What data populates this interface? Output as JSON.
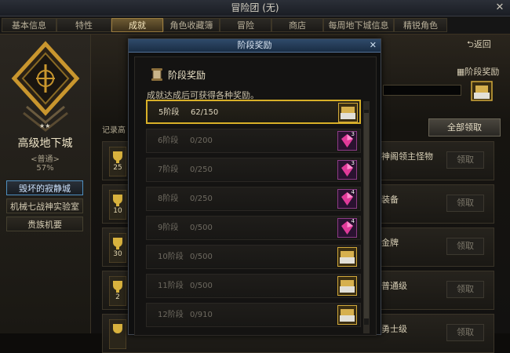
{
  "window": {
    "title": "冒险团 (无)",
    "close_label": "✕"
  },
  "tabs": [
    {
      "label": "基本信息",
      "active": false
    },
    {
      "label": "特性",
      "active": false
    },
    {
      "label": "成就",
      "active": true
    },
    {
      "label": "角色收藏簿",
      "active": false
    },
    {
      "label": "冒险",
      "active": false
    },
    {
      "label": "商店",
      "active": false
    },
    {
      "label": "每周地下城信息",
      "active": false
    },
    {
      "label": "精锐角色",
      "active": false
    }
  ],
  "left": {
    "title": "高级地下城",
    "difficulty": "<普通>",
    "percent": "57%",
    "dungeons": [
      {
        "label": "毁坏的寂静城",
        "active": true
      },
      {
        "label": "机械七战神实验室",
        "active": false
      },
      {
        "label": "贵族机要",
        "active": false
      }
    ]
  },
  "right": {
    "back_label": "返回",
    "stage_reward_label": "阶段奖励",
    "claim_all_label": "全部领取",
    "record_label": "记录高",
    "achievements": [
      {
        "count": "25",
        "text": "神阁领主怪物",
        "claim": "领取"
      },
      {
        "count": "10",
        "text": "装备",
        "claim": "领取"
      },
      {
        "count": "30",
        "text": "金牌",
        "claim": "领取"
      },
      {
        "count": "2",
        "text": "普通级",
        "claim": "领取"
      },
      {
        "count": "",
        "text": "勇士级",
        "claim": "领取"
      }
    ]
  },
  "modal": {
    "title": "阶段奖励",
    "close_label": "✕",
    "heading": "阶段奖励",
    "description": "成就达成后可获得各种奖励。",
    "stages": [
      {
        "name": "5阶段",
        "progress": "62/150",
        "reward": "box",
        "count": "",
        "active": true
      },
      {
        "name": "6阶段",
        "progress": "0/200",
        "reward": "gem",
        "count": "3",
        "active": false
      },
      {
        "name": "7阶段",
        "progress": "0/250",
        "reward": "gem",
        "count": "3",
        "active": false
      },
      {
        "name": "8阶段",
        "progress": "0/250",
        "reward": "gem",
        "count": "4",
        "active": false
      },
      {
        "name": "9阶段",
        "progress": "0/500",
        "reward": "gem",
        "count": "4",
        "active": false
      },
      {
        "name": "10阶段",
        "progress": "0/500",
        "reward": "box",
        "count": "",
        "active": false
      },
      {
        "name": "11阶段",
        "progress": "0/500",
        "reward": "box",
        "count": "",
        "active": false
      },
      {
        "name": "12阶段",
        "progress": "0/910",
        "reward": "box",
        "count": "",
        "active": false
      }
    ]
  },
  "colors": {
    "accent_gold": "#d8b028",
    "selected_blue": "#4f8fbf"
  }
}
